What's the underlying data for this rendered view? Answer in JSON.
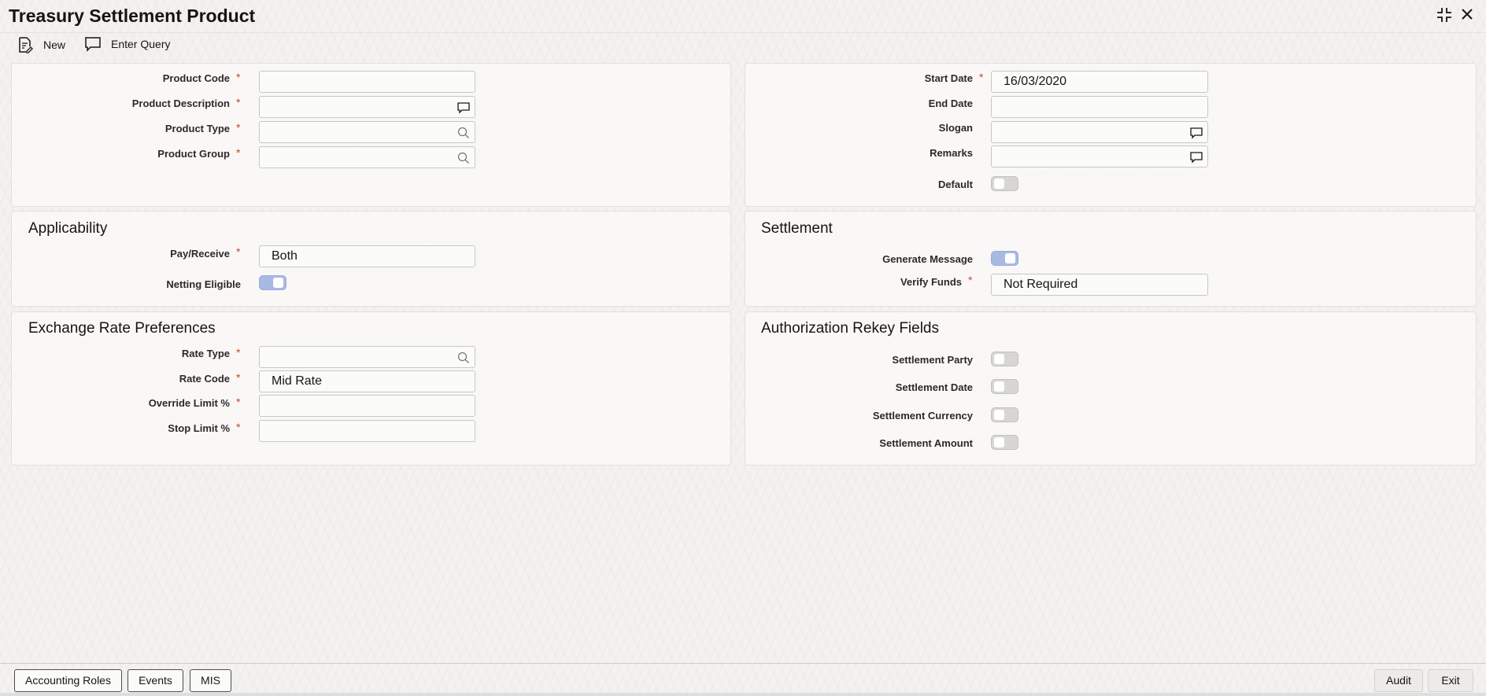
{
  "window": {
    "title": "Treasury Settlement Product",
    "restore_icon": "compress-icon",
    "close_icon": "close-icon"
  },
  "toolbar": {
    "new_label": "New",
    "enter_query_label": "Enter Query"
  },
  "main": {
    "product_code": {
      "label": "Product Code",
      "value": ""
    },
    "product_description": {
      "label": "Product Description",
      "value": ""
    },
    "product_type": {
      "label": "Product Type",
      "value": ""
    },
    "product_group": {
      "label": "Product Group",
      "value": ""
    },
    "start_date": {
      "label": "Start Date",
      "value": "16/03/2020"
    },
    "end_date": {
      "label": "End Date",
      "value": ""
    },
    "slogan": {
      "label": "Slogan",
      "value": ""
    },
    "remarks": {
      "label": "Remarks",
      "value": ""
    },
    "default": {
      "label": "Default",
      "on": false
    }
  },
  "applicability": {
    "title": "Applicability",
    "pay_receive": {
      "label": "Pay/Receive",
      "value": "Both"
    },
    "netting_eligible": {
      "label": "Netting Eligible",
      "on": true
    }
  },
  "settlement": {
    "title": "Settlement",
    "generate_message": {
      "label": "Generate Message",
      "on": true
    },
    "verify_funds": {
      "label": "Verify Funds",
      "value": "Not Required"
    }
  },
  "exchange_rate": {
    "title": "Exchange Rate Preferences",
    "rate_type": {
      "label": "Rate Type",
      "value": ""
    },
    "rate_code": {
      "label": "Rate Code",
      "value": "Mid Rate"
    },
    "override_limit": {
      "label": "Override Limit %",
      "value": ""
    },
    "stop_limit": {
      "label": "Stop Limit %",
      "value": ""
    }
  },
  "rekey": {
    "title": "Authorization Rekey Fields",
    "settlement_party": {
      "label": "Settlement Party",
      "on": false
    },
    "settlement_date": {
      "label": "Settlement Date",
      "on": false
    },
    "settlement_currency": {
      "label": "Settlement Currency",
      "on": false
    },
    "settlement_amount": {
      "label": "Settlement Amount",
      "on": false
    }
  },
  "footer": {
    "accounting_roles": "Accounting Roles",
    "events": "Events",
    "mis": "MIS",
    "audit": "Audit",
    "exit": "Exit"
  },
  "colors": {
    "required": "#c7491f",
    "toggle_on": "#aab9e4"
  }
}
